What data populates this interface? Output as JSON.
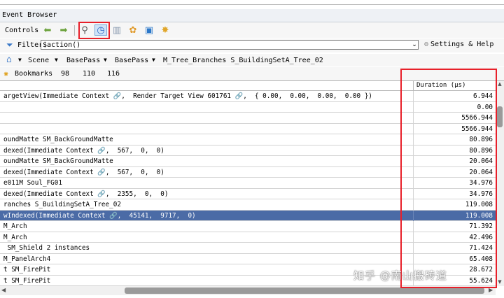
{
  "window": {
    "title": "Event Browser"
  },
  "toolbar": {
    "label": "Controls",
    "icons": [
      "arrow-left-icon",
      "arrow-right-icon",
      "binoculars-icon",
      "clock-icon",
      "column-icon",
      "gear-flower-icon",
      "save-icon",
      "star-gear-icon"
    ]
  },
  "filter": {
    "label": "Filter",
    "value": "$action()",
    "settings": "Settings & Help"
  },
  "breadcrumb": [
    "Scene",
    "BasePass",
    "BasePass",
    "M_Tree_Branches S_BuildingSetA_Tree_02"
  ],
  "bookmarks": {
    "label": "Bookmarks",
    "items": [
      "98",
      "110",
      "116"
    ]
  },
  "grid": {
    "header": "Duration (µs)",
    "rows": [
      {
        "name": "argetView(Immediate Context 🔗,  Render Target View 601761 🔗,  { 0.00,  0.00,  0.00,  0.00 })",
        "value": "6.944"
      },
      {
        "name": "",
        "value": "0.00"
      },
      {
        "name": "",
        "value": "5566.944"
      },
      {
        "name": "",
        "value": "5566.944"
      },
      {
        "name": "oundMatte SM_BackGroundMatte",
        "value": "80.896"
      },
      {
        "name": "dexed(Immediate Context 🔗,  567,  0,  0)",
        "value": "80.896"
      },
      {
        "name": "oundMatte SM_BackGroundMatte",
        "value": "20.064"
      },
      {
        "name": "dexed(Immediate Context 🔗,  567,  0,  0)",
        "value": "20.064"
      },
      {
        "name": "e011M Soul_FG01",
        "value": "34.976"
      },
      {
        "name": "dexed(Immediate Context 🔗,  2355,  0,  0)",
        "value": "34.976"
      },
      {
        "name": "ranches S_BuildingSetA_Tree_02",
        "value": "119.008"
      },
      {
        "name": "wIndexed(Immediate Context 🔗,  45141,  9717,  0)",
        "value": "119.008"
      },
      {
        "name": "M_Arch",
        "value": "71.392"
      },
      {
        "name": "M_Arch",
        "value": "42.496"
      },
      {
        "name": " SM_Shield 2 instances",
        "value": "71.424"
      },
      {
        "name": "M_PanelArch4",
        "value": "65.408"
      },
      {
        "name": "t SM_FirePit",
        "value": "28.672"
      },
      {
        "name": "t SM_FirePit",
        "value": "55.624"
      }
    ]
  },
  "watermark": "知乎 @南山搬砖道",
  "colors": {
    "selection": "#4b6ba6",
    "highlight_box": "#e8202a",
    "toolbar_bg": "#f6f6f6"
  }
}
